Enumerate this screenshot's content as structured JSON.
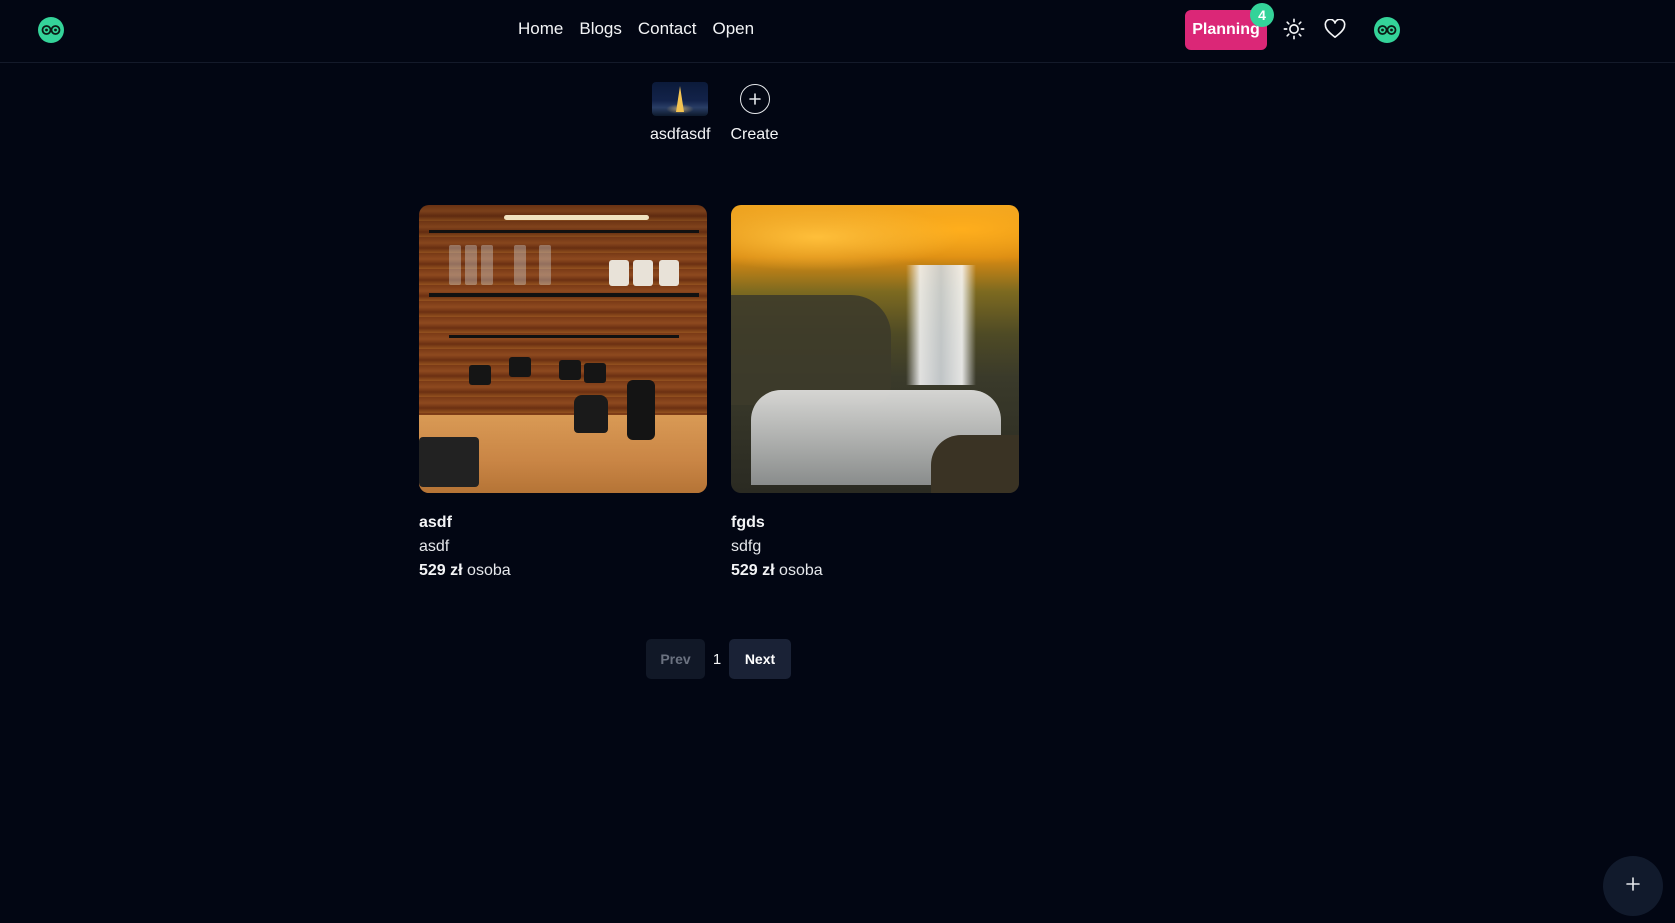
{
  "header": {
    "logo_icon": "owl-logo-icon",
    "nav": [
      {
        "label": "Home"
      },
      {
        "label": "Blogs"
      },
      {
        "label": "Contact"
      },
      {
        "label": "Open"
      }
    ],
    "planning": {
      "label": "Planning",
      "badge": "4"
    },
    "theme_icon": "sun-icon",
    "favorites_icon": "heart-icon",
    "avatar_icon": "owl-avatar-icon"
  },
  "stories": [
    {
      "label": "asdfasdf",
      "image": "eiffel-tower-night"
    },
    {
      "label": "Create",
      "icon": "plus-circle-icon"
    }
  ],
  "cards": [
    {
      "title": "asdf",
      "description": "asdf",
      "price": "529 zł",
      "unit": "osoba",
      "image": "kitchen-coffee-bar"
    },
    {
      "title": "fgds",
      "description": "sdfg",
      "price": "529 zł",
      "unit": "osoba",
      "image": "autumn-waterfall"
    }
  ],
  "pagination": {
    "prev": "Prev",
    "current": "1",
    "next": "Next"
  },
  "fab": {
    "icon": "plus-icon"
  },
  "colors": {
    "background": "#020613",
    "accent_pink": "#db2777",
    "accent_green": "#34d399"
  }
}
